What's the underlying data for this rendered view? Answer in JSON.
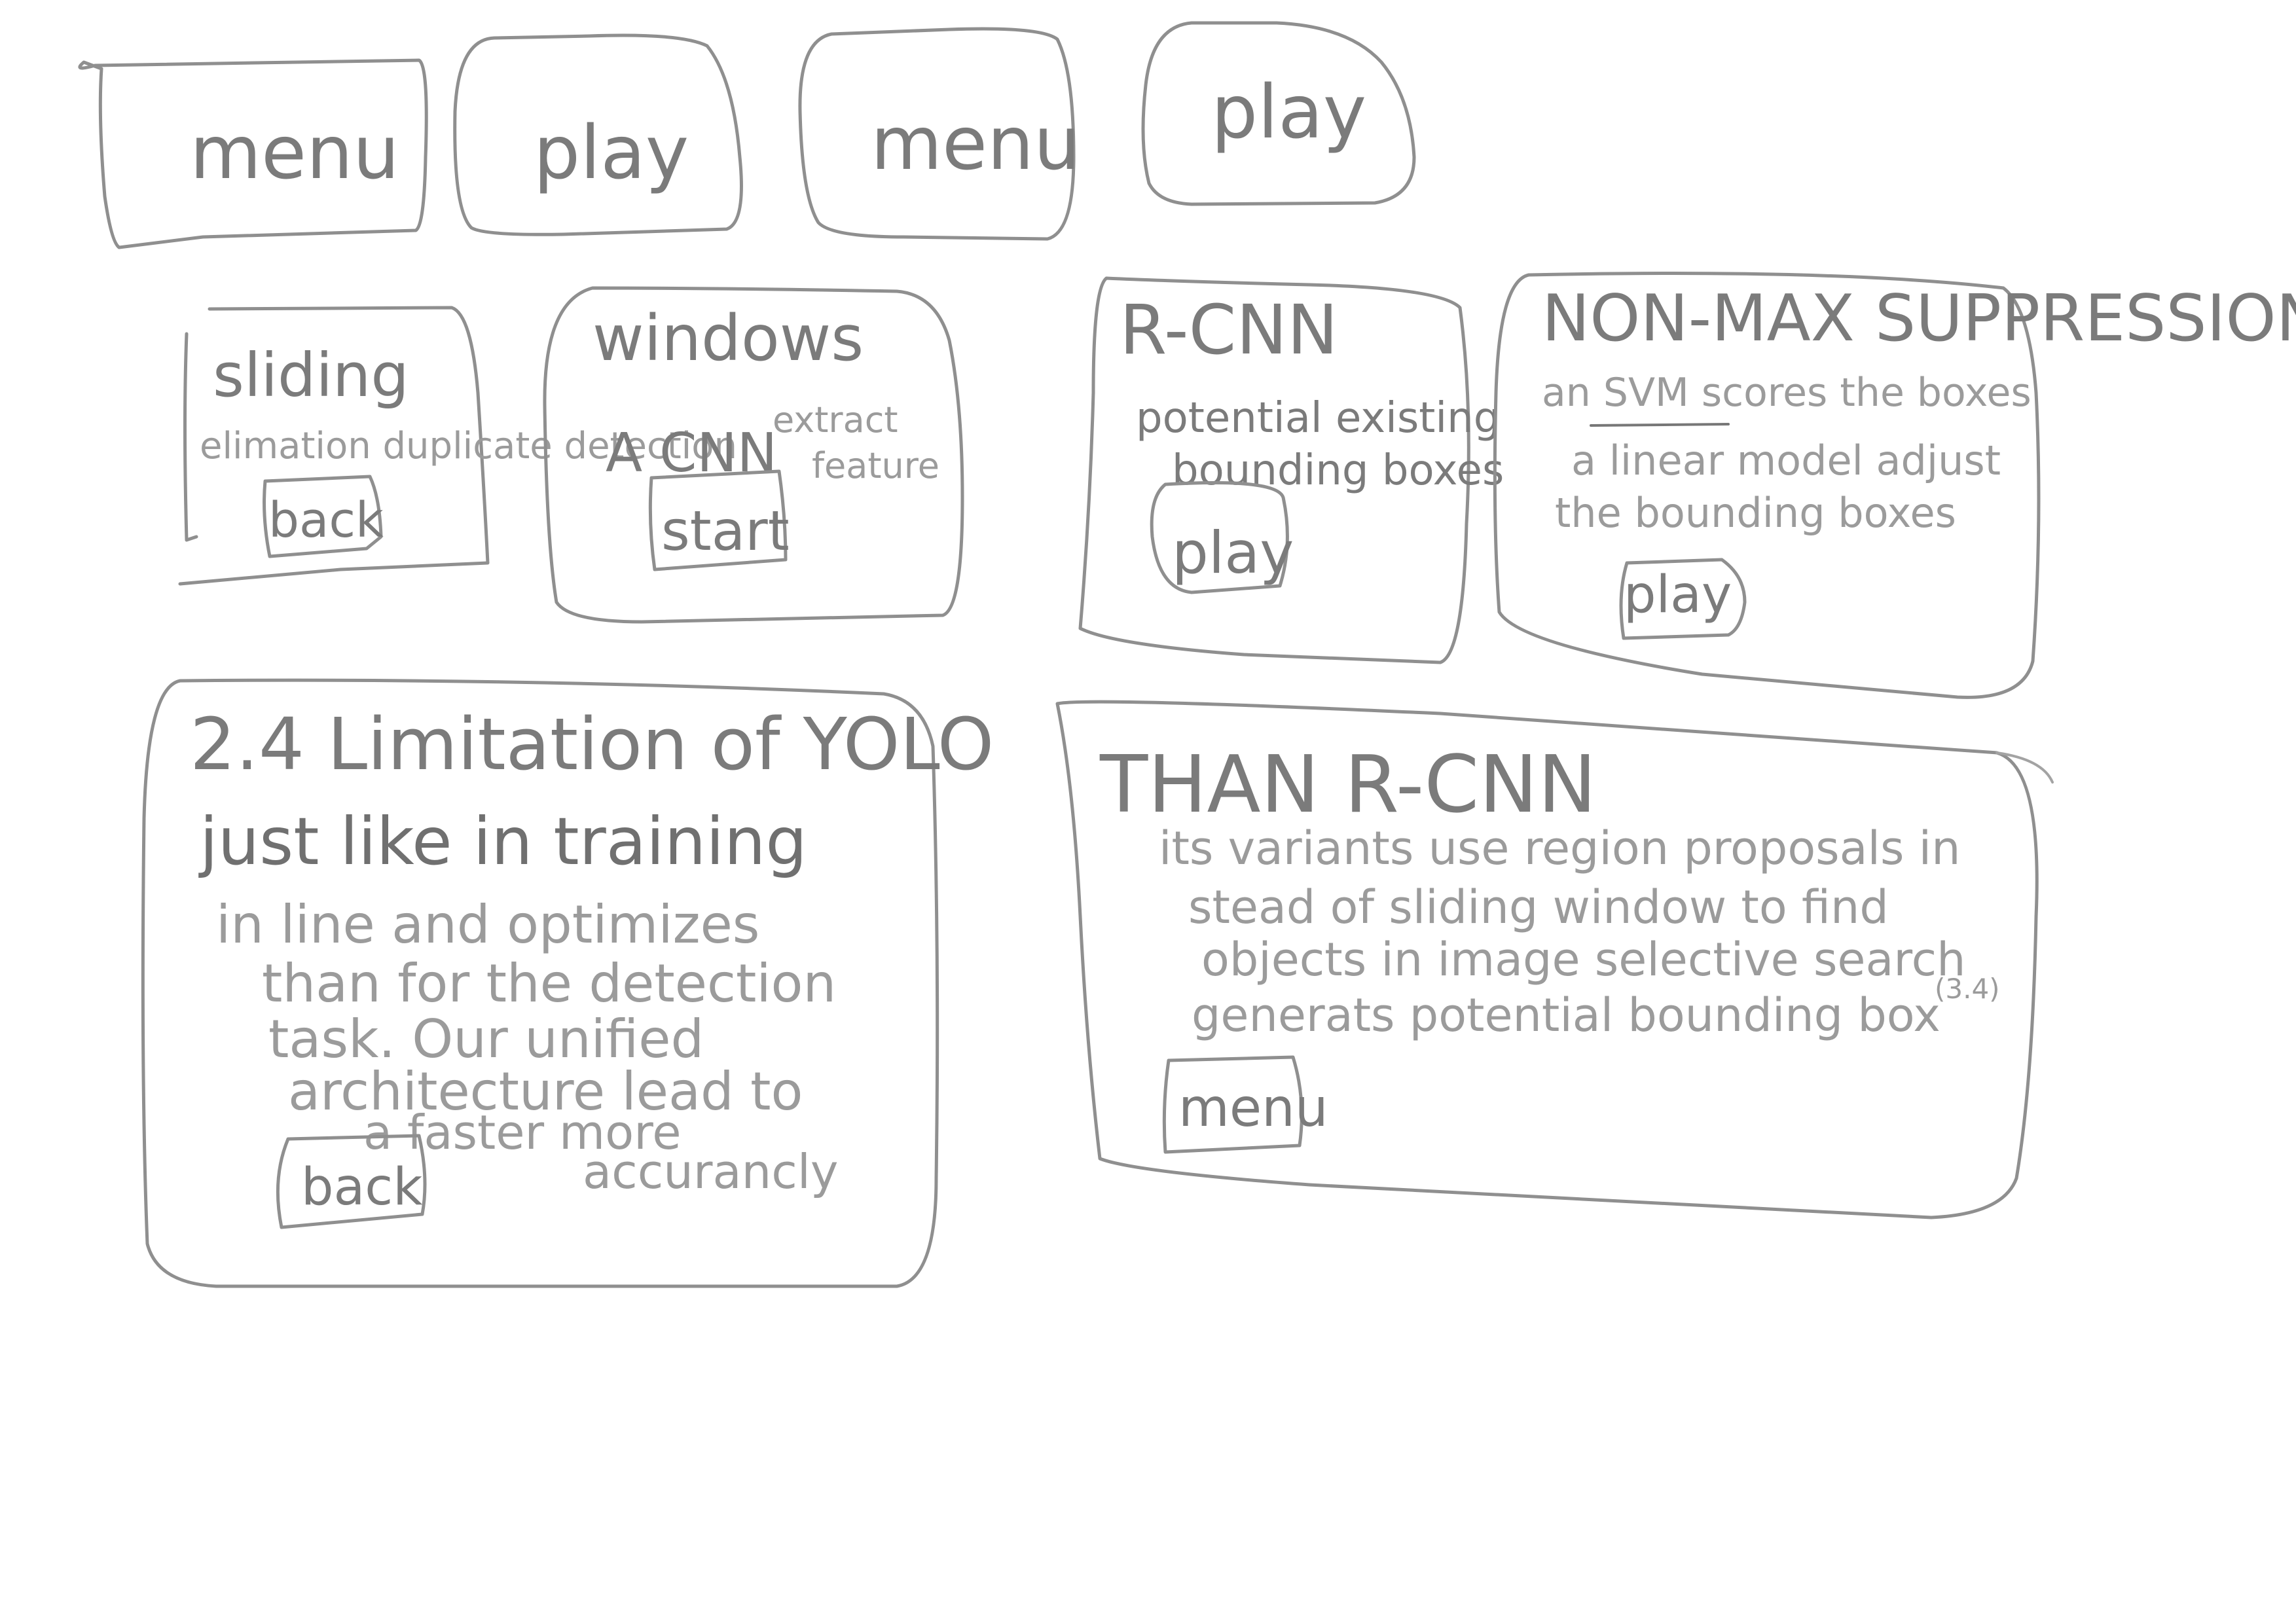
{
  "nav": {
    "buttons": [
      {
        "label": "menu"
      },
      {
        "label": "play"
      },
      {
        "label": "menu"
      },
      {
        "label": "play"
      }
    ]
  },
  "cards": {
    "sliding": {
      "title": "sliding",
      "body": "elimation duplicate detection",
      "button": "back"
    },
    "windows": {
      "title": "windows",
      "body_a": "A CNN",
      "body_b": "extract",
      "body_c": "feature",
      "button": "start"
    },
    "rcnn": {
      "title": "R-CNN",
      "line1": "potential existing",
      "line2": "bounding boxes",
      "button": "play"
    },
    "nonmax": {
      "title": "NON-MAX SUPPRESSION",
      "line1": "an SVM scores the boxes",
      "line2": "a linear model adjust",
      "line3": "the bounding boxes",
      "button": "play"
    },
    "yolo": {
      "title": "2.4 Limitation of YOLO",
      "line1": "just like in training",
      "line2": "in line and optimizes",
      "line3": "than for the detection",
      "line4": "task. Our unified",
      "line5": "architecture lead to",
      "line6": "a faster more",
      "line7": "accurancly",
      "button": "back"
    },
    "thanrcnn": {
      "title": "THAN R-CNN",
      "line1": "its variants use region proposals in",
      "line2": "stead of sliding window to find",
      "line3": "objects in image selective search",
      "line4": "generats potential bounding box",
      "note": "(3.4)",
      "button": "menu"
    }
  }
}
